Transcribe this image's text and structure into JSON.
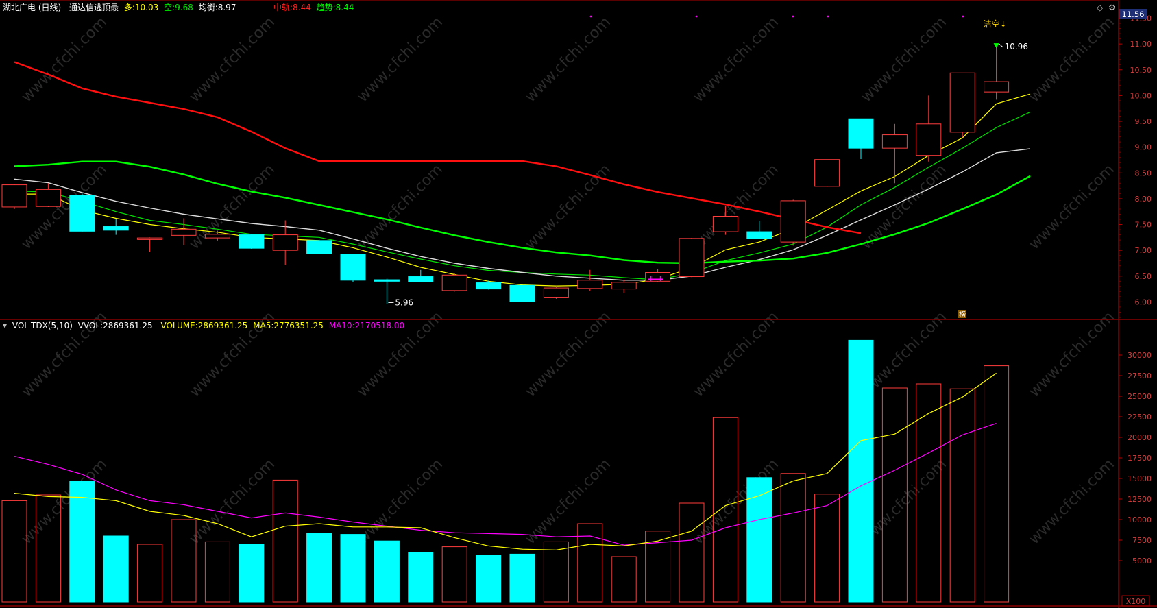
{
  "header": {
    "stock": "湖北广电 (日线)",
    "indicator": "通达信逃顶最",
    "duo_label": "多:",
    "duo_value": "10.03",
    "kong_label": "空:",
    "kong_value": "9.68",
    "junheng_label": "均衡:",
    "junheng_value": "8.97",
    "zhonggui_label": "中轨:",
    "zhonggui_value": "8.44",
    "qushi_label": "趋势:",
    "qushi_value": "8.44"
  },
  "vol_header": {
    "name": "VOL-TDX(5,10)",
    "vvol_label": "VVOL:",
    "vvol_value": "2869361.25",
    "volume_label": "VOLUME:",
    "volume_value": "2869361.25",
    "ma5_label": "MA5:",
    "ma5_value": "2776351.25",
    "ma10_label": "MA10:",
    "ma10_value": "2170518.00"
  },
  "price_axis": {
    "current": "11.56",
    "ticks": [
      "11.50",
      "11.00",
      "10.50",
      "10.00",
      "9.50",
      "9.00",
      "8.50",
      "8.00",
      "7.50",
      "7.00",
      "6.50",
      "6.00"
    ]
  },
  "vol_axis": {
    "ticks": [
      "30000",
      "27500",
      "25000",
      "22500",
      "20000",
      "17500",
      "15000",
      "12500",
      "10000",
      "7500",
      "5000"
    ],
    "unit": "X100"
  },
  "annotations": {
    "high_label": "10.96",
    "low_label": "5.96",
    "signal": "洁空↓",
    "marker": "榜"
  },
  "watermark": "www.cfchi.com",
  "colors": {
    "up": "#ff3c3c",
    "down": "#00ffff",
    "ma_white": "#dcdcdc",
    "ma_yellow": "#ffff00",
    "ma_green_thin": "#00e600",
    "ma_green_thick": "#00ff00",
    "ma_red": "#ff1010",
    "ma10_vol": "#ff00ff"
  },
  "chart_data": [
    {
      "type": "candlestick",
      "title": "湖北广电 (日线)",
      "candles": [
        {
          "o": 7.84,
          "h": 8.29,
          "l": 7.8,
          "c": 8.27
        },
        {
          "o": 7.85,
          "h": 8.3,
          "l": 7.84,
          "c": 8.18
        },
        {
          "o": 8.06,
          "h": 8.1,
          "l": 7.36,
          "c": 7.37
        },
        {
          "o": 7.46,
          "h": 7.6,
          "l": 7.3,
          "c": 7.39
        },
        {
          "o": 7.21,
          "h": 7.25,
          "l": 6.97,
          "c": 7.24
        },
        {
          "o": 7.29,
          "h": 7.62,
          "l": 7.1,
          "c": 7.41
        },
        {
          "o": 7.24,
          "h": 7.38,
          "l": 7.19,
          "c": 7.31
        },
        {
          "o": 7.3,
          "h": 7.32,
          "l": 7.03,
          "c": 7.04
        },
        {
          "o": 7.0,
          "h": 7.58,
          "l": 6.72,
          "c": 7.3
        },
        {
          "o": 7.19,
          "h": 7.21,
          "l": 6.93,
          "c": 6.94
        },
        {
          "o": 6.92,
          "h": 6.92,
          "l": 6.38,
          "c": 6.42
        },
        {
          "o": 6.43,
          "h": 6.45,
          "l": 5.96,
          "c": 6.4
        },
        {
          "o": 6.49,
          "h": 6.62,
          "l": 6.38,
          "c": 6.39
        },
        {
          "o": 6.22,
          "h": 6.55,
          "l": 6.2,
          "c": 6.52
        },
        {
          "o": 6.37,
          "h": 6.41,
          "l": 6.24,
          "c": 6.25
        },
        {
          "o": 6.32,
          "h": 6.32,
          "l": 6.01,
          "c": 6.01
        },
        {
          "o": 6.08,
          "h": 6.31,
          "l": 6.06,
          "c": 6.27
        },
        {
          "o": 6.26,
          "h": 6.62,
          "l": 6.21,
          "c": 6.42
        },
        {
          "o": 6.25,
          "h": 6.43,
          "l": 6.17,
          "c": 6.38
        },
        {
          "o": 6.4,
          "h": 6.63,
          "l": 6.38,
          "c": 6.57
        },
        {
          "o": 6.49,
          "h": 7.24,
          "l": 6.48,
          "c": 7.23
        },
        {
          "o": 7.36,
          "h": 7.86,
          "l": 7.3,
          "c": 7.66
        },
        {
          "o": 7.36,
          "h": 7.57,
          "l": 7.22,
          "c": 7.23
        },
        {
          "o": 7.16,
          "h": 7.98,
          "l": 7.09,
          "c": 7.96
        },
        {
          "o": 8.24,
          "h": 8.76,
          "l": 8.23,
          "c": 8.76
        },
        {
          "o": 9.55,
          "h": 9.55,
          "l": 8.77,
          "c": 8.98
        },
        {
          "o": 8.98,
          "h": 9.45,
          "l": 8.3,
          "c": 9.24
        },
        {
          "o": 8.84,
          "h": 10.0,
          "l": 8.72,
          "c": 9.45
        },
        {
          "o": 9.29,
          "h": 10.44,
          "l": 9.19,
          "c": 10.44
        },
        {
          "o": 10.07,
          "h": 10.96,
          "l": 9.92,
          "c": 10.27
        }
      ],
      "ma_lines": [
        {
          "name": "多",
          "color": "#ffff00",
          "values": [
            8.09,
            8.09,
            7.78,
            7.62,
            7.5,
            7.42,
            7.35,
            7.25,
            7.22,
            7.19,
            7.05,
            6.87,
            6.67,
            6.53,
            6.4,
            6.33,
            6.31,
            6.32,
            6.34,
            6.44,
            6.66,
            7.01,
            7.16,
            7.42,
            7.78,
            8.15,
            8.43,
            8.84,
            9.18,
            9.84,
            10.03
          ]
        },
        {
          "name": "空",
          "color": "#00e600",
          "values": [
            8.15,
            8.13,
            7.95,
            7.75,
            7.58,
            7.5,
            7.41,
            7.31,
            7.28,
            7.25,
            7.12,
            6.97,
            6.83,
            6.7,
            6.61,
            6.57,
            6.54,
            6.52,
            6.47,
            6.43,
            6.56,
            6.8,
            6.95,
            7.12,
            7.45,
            7.88,
            8.22,
            8.61,
            8.98,
            9.38,
            9.68
          ]
        },
        {
          "name": "均衡",
          "color": "#dcdcdc",
          "values": [
            8.38,
            8.31,
            8.12,
            7.95,
            7.82,
            7.7,
            7.61,
            7.52,
            7.46,
            7.39,
            7.22,
            7.04,
            6.88,
            6.75,
            6.65,
            6.57,
            6.5,
            6.46,
            6.42,
            6.42,
            6.5,
            6.67,
            6.82,
            7.01,
            7.29,
            7.59,
            7.88,
            8.19,
            8.52,
            8.89,
            8.97
          ]
        },
        {
          "name": "趋势",
          "color": "#00ff00",
          "values": [
            8.63,
            8.66,
            8.72,
            8.72,
            8.62,
            8.47,
            8.29,
            8.14,
            8.02,
            7.88,
            7.74,
            7.6,
            7.44,
            7.29,
            7.16,
            7.05,
            6.96,
            6.9,
            6.81,
            6.76,
            6.75,
            6.78,
            6.8,
            6.84,
            6.95,
            7.12,
            7.31,
            7.53,
            7.8,
            8.08,
            8.44
          ]
        },
        {
          "name": "中轨",
          "color": "#ff1010",
          "values": [
            10.65,
            10.41,
            10.14,
            9.98,
            9.86,
            9.74,
            9.58,
            9.3,
            8.98,
            8.73,
            8.73,
            8.73,
            8.73,
            8.73,
            8.73,
            8.73,
            8.63,
            8.46,
            8.28,
            8.13,
            8.01,
            7.89,
            7.75,
            7.6,
            7.45,
            7.33,
            null,
            null,
            null,
            null,
            null
          ]
        }
      ],
      "ylim": [
        5.66,
        11.56
      ]
    },
    {
      "type": "bar",
      "title": "VOL-TDX(5,10)",
      "values": [
        12300,
        13000,
        14700,
        8000,
        7000,
        10000,
        7300,
        7000,
        14800,
        8300,
        8200,
        7400,
        6000,
        6700,
        5700,
        5800,
        7300,
        9500,
        5500,
        8600,
        12000,
        22400,
        15100,
        15600,
        13100,
        31800,
        26000,
        26500,
        25900,
        28700
      ],
      "ma5": [
        13200,
        12800,
        12700,
        12300,
        11000,
        10500,
        9500,
        7900,
        9200,
        9500,
        9100,
        9100,
        9000,
        7800,
        6800,
        6400,
        6300,
        7000,
        6800,
        7400,
        8600,
        11700,
        12900,
        14700,
        15600,
        19600,
        20400,
        22900,
        24900,
        27800
      ],
      "ma10": [
        17700,
        16700,
        15500,
        13600,
        12300,
        11800,
        11000,
        10200,
        10800,
        10300,
        9700,
        9200,
        8700,
        8400,
        8300,
        8200,
        7900,
        8000,
        6900,
        7200,
        7500,
        9000,
        10000,
        10800,
        11700,
        14100,
        16000,
        18100,
        20300,
        21700
      ],
      "ylim": [
        0,
        33000
      ]
    }
  ]
}
